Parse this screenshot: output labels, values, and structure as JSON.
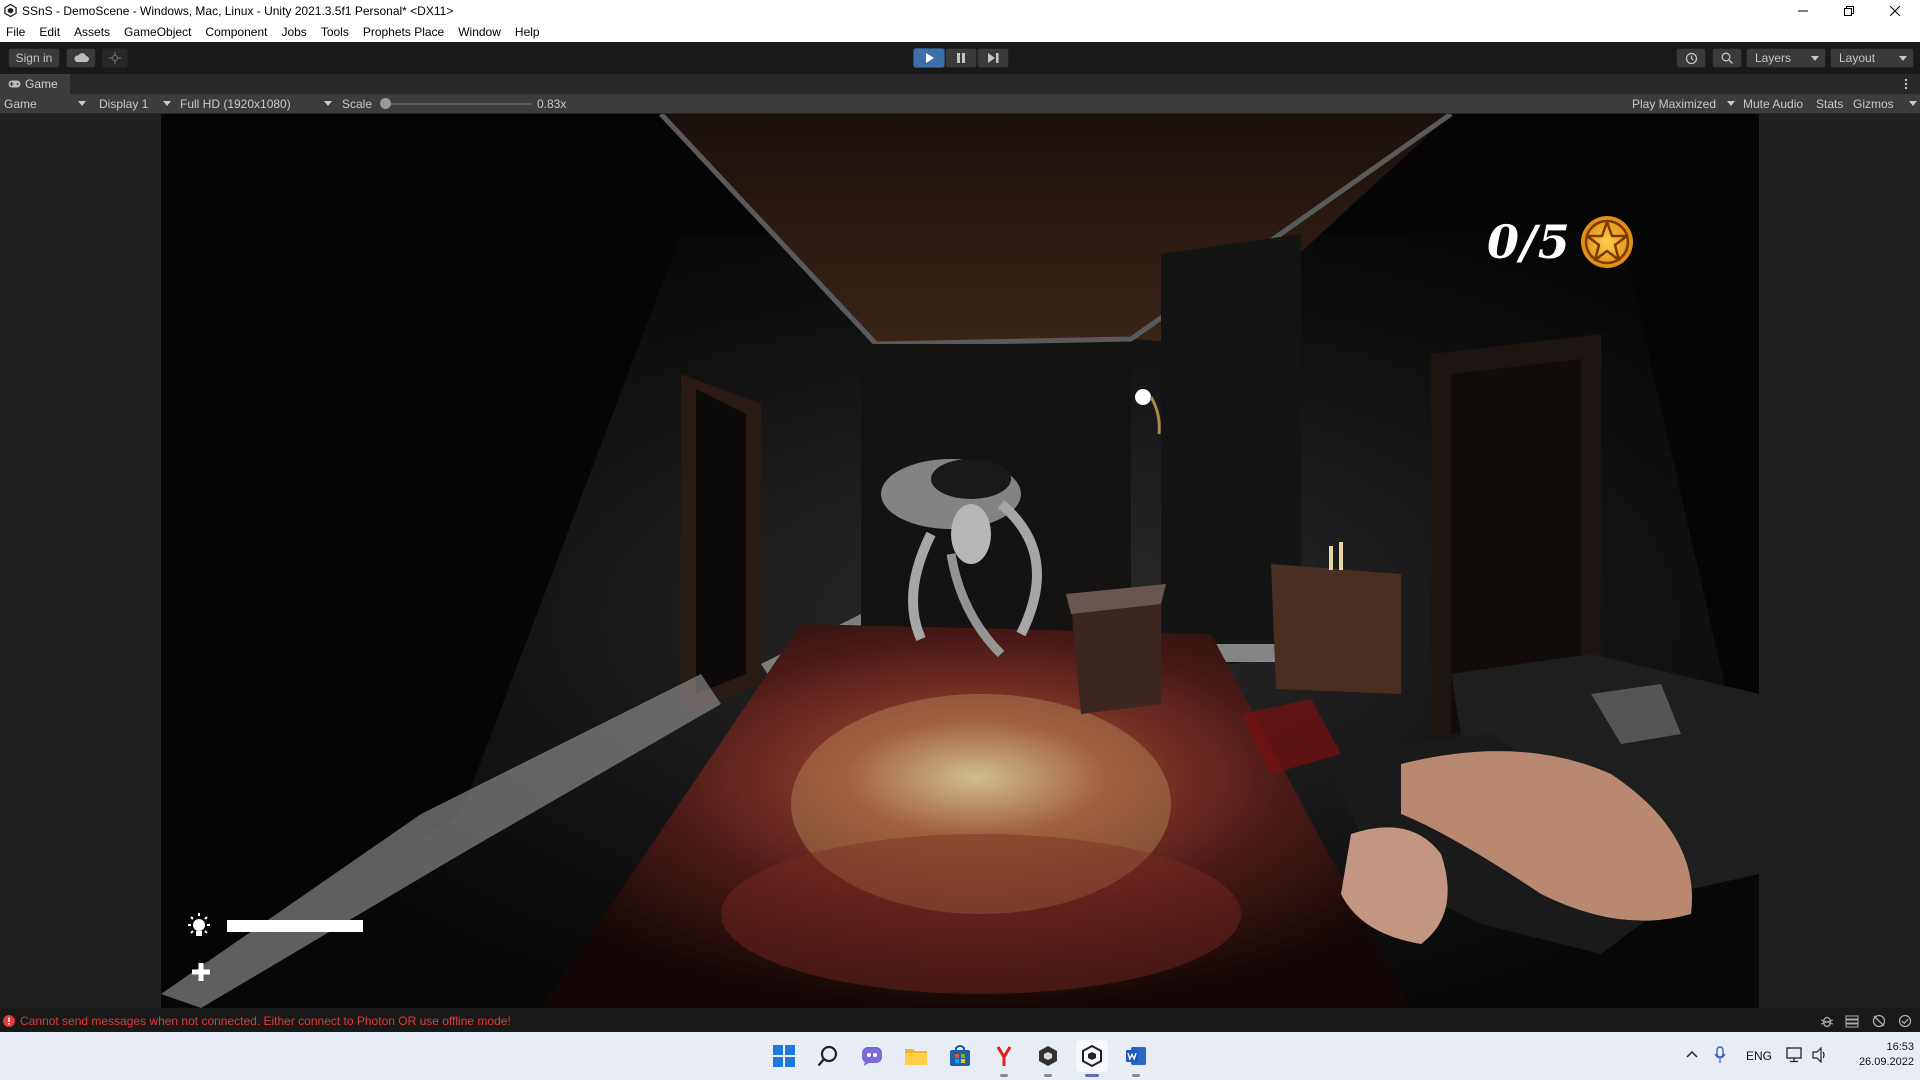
{
  "window": {
    "title": "SSnS - DemoScene - Windows, Mac, Linux - Unity 2021.3.5f1 Personal* <DX11>"
  },
  "menu": [
    "File",
    "Edit",
    "Assets",
    "GameObject",
    "Component",
    "Jobs",
    "Tools",
    "Prophets Place",
    "Window",
    "Help"
  ],
  "toolbar": {
    "sign_in": "Sign in",
    "layers": "Layers",
    "layout": "Layout"
  },
  "game_tab": {
    "label": "Game",
    "view_mode": "Game",
    "display": "Display 1",
    "resolution": "Full HD (1920x1080)",
    "scale_label": "Scale",
    "scale_value": "0.83x",
    "scale_fraction": 0.0,
    "play_maximized": "Play Maximized",
    "mute_audio": "Mute Audio",
    "stats": "Stats",
    "gizmos": "Gizmos"
  },
  "hud": {
    "counter": "0/5",
    "flashlight_level": 1.0,
    "colors": {
      "pentagram": "#f0a020",
      "hud_text": "#ffffff"
    }
  },
  "status": {
    "message": "Cannot send messages when not connected. Either connect to Photon OR use offline mode!",
    "color": "#e03a3a"
  },
  "taskbar": {
    "apps": [
      "windows-start-icon",
      "search-icon",
      "chat-icon",
      "file-explorer-icon",
      "store-icon",
      "yandex-browser-icon",
      "unity-hub-icon",
      "unity-editor-icon",
      "word-icon"
    ],
    "language": "ENG",
    "time": "16:53",
    "date": "26.09.2022"
  }
}
